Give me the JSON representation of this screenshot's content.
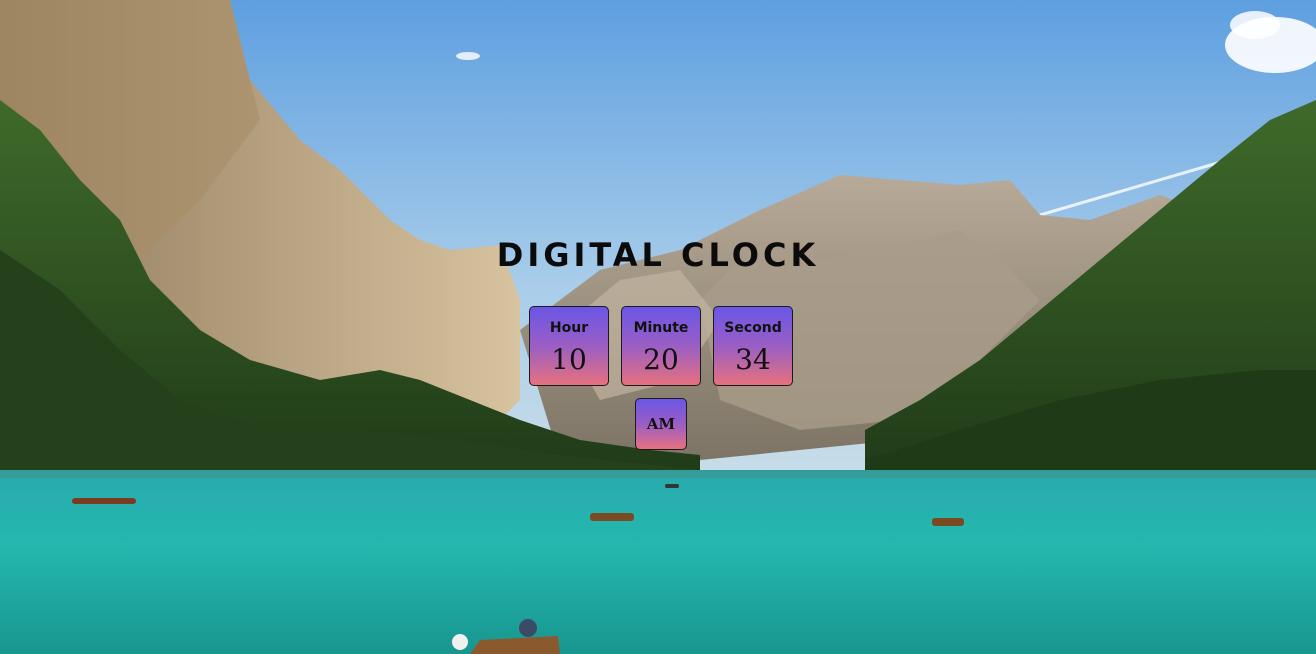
{
  "title": "DIGITAL CLOCK",
  "clock": {
    "hour_label": "Hour",
    "hour_value": "10",
    "minute_label": "Minute",
    "minute_value": "20",
    "second_label": "Second",
    "second_value": "34",
    "period": "AM"
  },
  "background": {
    "description_icon": "mountain-lake-photo-icon"
  },
  "colors": {
    "box_gradient_top": "#6a56e6",
    "box_gradient_bottom": "#e7717f",
    "title_color": "#0b0b0b",
    "sky": "#86b6e4",
    "lake": "#23b2ad"
  }
}
